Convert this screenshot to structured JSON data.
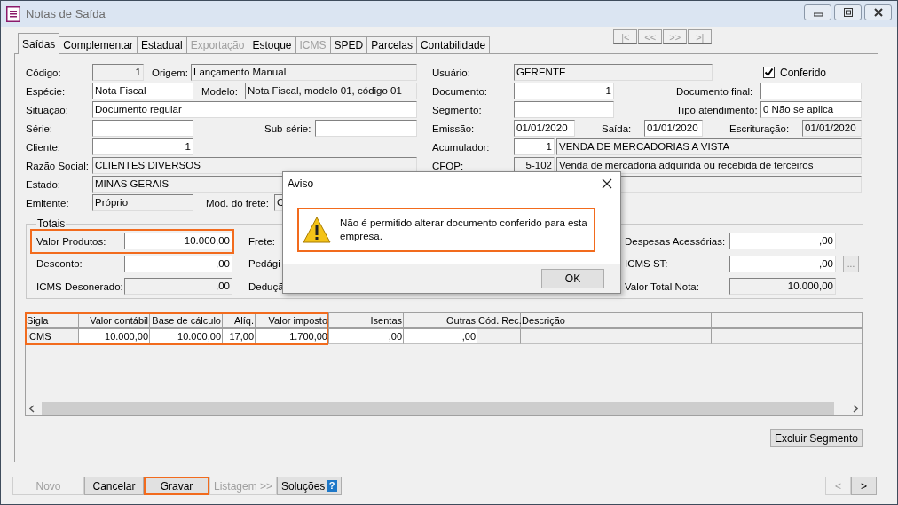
{
  "window": {
    "title": "Notas de Saída",
    "active": false
  },
  "tabs": [
    {
      "label": "Saídas",
      "selected": true,
      "disabled": false
    },
    {
      "label": "Complementar",
      "selected": false,
      "disabled": false
    },
    {
      "label": "Estadual",
      "selected": false,
      "disabled": false
    },
    {
      "label": "Exportação",
      "selected": false,
      "disabled": true
    },
    {
      "label": "Estoque",
      "selected": false,
      "disabled": false
    },
    {
      "label": "ICMS",
      "selected": false,
      "disabled": true
    },
    {
      "label": "SPED",
      "selected": false,
      "disabled": false
    },
    {
      "label": "Parcelas",
      "selected": false,
      "disabled": false
    },
    {
      "label": "Contabilidade",
      "selected": false,
      "disabled": false
    }
  ],
  "record_nav": [
    {
      "label": "|<",
      "disabled": true
    },
    {
      "label": "<<",
      "disabled": true
    },
    {
      "label": ">>",
      "disabled": true
    },
    {
      "label": ">|",
      "disabled": true
    }
  ],
  "form": {
    "left": [
      [
        {
          "kind": "label",
          "text": "Código:"
        },
        {
          "kind": "field",
          "value": "1",
          "readonly": true
        },
        {
          "kind": "label",
          "text": "Origem:"
        },
        {
          "kind": "field",
          "value": "Lançamento Manual",
          "readonly": true
        }
      ],
      [
        {
          "kind": "label",
          "text": "Espécie:"
        },
        {
          "kind": "field",
          "value": "Nota Fiscal",
          "readonly": false
        },
        {
          "kind": "label",
          "text": "Modelo:"
        },
        {
          "kind": "field",
          "value": "Nota Fiscal, modelo 01, código 01",
          "readonly": true
        }
      ],
      [
        {
          "kind": "label",
          "text": "Situação:"
        },
        {
          "kind": "field",
          "value": "Documento regular",
          "readonly": false
        }
      ],
      [
        {
          "kind": "label",
          "text": "Série:"
        },
        {
          "kind": "field",
          "readonly": false
        },
        {
          "kind": "label",
          "text": "Sub-série:"
        },
        {
          "kind": "field",
          "readonly": false
        }
      ],
      [
        {
          "kind": "label",
          "text": "Cliente:"
        },
        {
          "kind": "field",
          "value": "1",
          "readonly": false
        }
      ],
      [
        {
          "kind": "label",
          "text": "Razão Social:"
        },
        {
          "kind": "field",
          "value": "CLIENTES DIVERSOS",
          "readonly": true
        }
      ],
      [
        {
          "kind": "label",
          "text": "Estado:"
        },
        {
          "kind": "field",
          "value": "MINAS GERAIS",
          "readonly": true
        }
      ],
      [
        {
          "kind": "label",
          "text": "Emitente:"
        },
        {
          "kind": "field",
          "value": "Próprio",
          "readonly": true
        },
        {
          "kind": "label",
          "text": "Mod. do frete:"
        },
        {
          "kind": "field",
          "value": "C",
          "readonly": true
        }
      ]
    ],
    "right": [
      [
        {
          "kind": "label",
          "text": "Usuário:"
        },
        {
          "kind": "field",
          "value": "GERENTE",
          "readonly": true
        },
        {
          "kind": "checkbox",
          "label": "Conferido",
          "checked": true
        }
      ],
      [
        {
          "kind": "label",
          "text": "Documento:"
        },
        {
          "kind": "field",
          "value": "1",
          "readonly": false
        },
        {
          "kind": "label",
          "text": "Documento final:"
        },
        {
          "kind": "field",
          "readonly": false
        }
      ],
      [
        {
          "kind": "label",
          "text": "Segmento:"
        },
        {
          "kind": "field",
          "readonly": false
        },
        {
          "kind": "label",
          "text": "Tipo atendimento:"
        },
        {
          "kind": "field",
          "value": "0 Não se aplica",
          "readonly": false
        }
      ],
      [
        {
          "kind": "label",
          "text": "Emissão:"
        },
        {
          "kind": "field",
          "value": "01/01/2020",
          "readonly": false
        },
        {
          "kind": "label",
          "text": "Saída:"
        },
        {
          "kind": "field",
          "value": "01/01/2020",
          "readonly": false
        },
        {
          "kind": "label",
          "text": "Escrituração:"
        },
        {
          "kind": "field",
          "value": "01/01/2020",
          "readonly": true
        }
      ],
      [
        {
          "kind": "label",
          "text": "Acumulador:"
        },
        {
          "kind": "field",
          "value": "1",
          "readonly": false
        },
        {
          "kind": "field",
          "value": "VENDA DE MERCADORIAS A VISTA",
          "readonly": true
        }
      ],
      [
        {
          "kind": "label",
          "text": "CFOP:"
        },
        {
          "kind": "field",
          "value": "5-102",
          "readonly": true
        },
        {
          "kind": "field",
          "value": "Venda de mercadoria adquirida ou recebida de terceiros",
          "readonly": true
        }
      ],
      [
        {
          "kind": "field",
          "readonly": true
        }
      ]
    ]
  },
  "totals": {
    "title": "Totais",
    "rows": [
      {
        "highlighted": true,
        "cells": [
          {
            "kind": "label",
            "text": "Valor Produtos:"
          },
          {
            "kind": "field",
            "value": "10.000,00",
            "readonly": false
          },
          {
            "kind": "label",
            "text": "Frete:"
          },
          {
            "kind": "label",
            "text": "Despesas Acessórias:"
          },
          {
            "kind": "field",
            "value": ",00",
            "readonly": false
          }
        ]
      },
      {
        "highlighted": false,
        "cells": [
          {
            "kind": "label",
            "text": "Desconto:"
          },
          {
            "kind": "field",
            "value": ",00",
            "readonly": false
          },
          {
            "kind": "label",
            "text": "Pedági"
          },
          {
            "kind": "label",
            "text": "ICMS ST:"
          },
          {
            "kind": "field",
            "value": ",00",
            "readonly": false
          },
          {
            "kind": "button",
            "label": "..."
          }
        ]
      },
      {
        "highlighted": false,
        "cells": [
          {
            "kind": "label",
            "text": "ICMS Desonerado:"
          },
          {
            "kind": "field",
            "value": ",00",
            "readonly": true
          },
          {
            "kind": "label",
            "text": "Deduçã"
          },
          {
            "kind": "label",
            "text": "Valor Total Nota:"
          },
          {
            "kind": "field",
            "value": "10.000,00",
            "readonly": true
          }
        ]
      }
    ]
  },
  "table": {
    "columns": [
      {
        "label": "Sigla",
        "highlighted": true
      },
      {
        "label": "Valor contábil",
        "highlighted": true
      },
      {
        "label": "Base de cálculo",
        "highlighted": true
      },
      {
        "label": "Alíq.",
        "highlighted": true
      },
      {
        "label": "Valor imposto",
        "highlighted": true
      },
      {
        "label": "Isentas",
        "highlighted": false
      },
      {
        "label": "Outras",
        "highlighted": false
      },
      {
        "label": "Cód. Rec.",
        "highlighted": false
      },
      {
        "label": "Descrição",
        "highlighted": false
      }
    ],
    "rows": [
      {
        "cells": [
          {
            "value": "ICMS",
            "editable": false
          },
          {
            "value": "10.000,00",
            "editable": true
          },
          {
            "value": "10.000,00",
            "editable": true
          },
          {
            "value": "17,00",
            "editable": true
          },
          {
            "value": "1.700,00",
            "editable": true
          },
          {
            "value": ",00",
            "editable": true
          },
          {
            "value": ",00",
            "editable": true
          },
          {
            "editable": false
          },
          {
            "editable": false
          }
        ]
      }
    ]
  },
  "panel_button": {
    "label": "Excluir Segmento"
  },
  "bottom_buttons": [
    {
      "label": "Novo",
      "disabled": true,
      "highlighted": false
    },
    {
      "label": "Cancelar",
      "disabled": false,
      "highlighted": false
    },
    {
      "label": "Gravar",
      "disabled": false,
      "highlighted": true
    },
    {
      "label": "Listagem >>",
      "disabled": true,
      "highlighted": false
    },
    {
      "label": "Soluções",
      "disabled": false,
      "highlighted": false,
      "kind": "help",
      "badge": "?"
    }
  ],
  "pager": [
    {
      "label": "<",
      "disabled": true
    },
    {
      "label": ">",
      "disabled": false
    }
  ],
  "dialog": {
    "title": "Aviso",
    "kind": "warning",
    "message": "Não é permitido alterar documento conferido para esta empresa.",
    "highlighted": true,
    "buttons": [
      {
        "label": "OK"
      }
    ]
  }
}
